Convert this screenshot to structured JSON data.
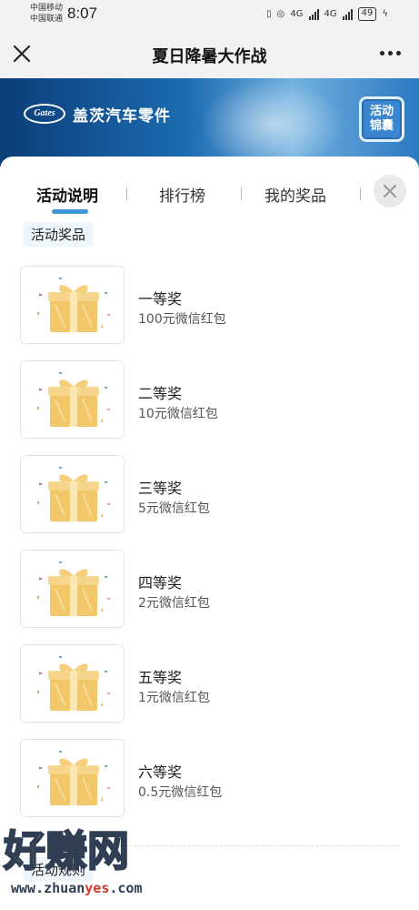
{
  "status_bar": {
    "carrier_1": "中国移动",
    "carrier_2": "中国联通",
    "time": "8:07",
    "net_1": "4G",
    "net_2": "4G",
    "battery": "49"
  },
  "nav": {
    "title": "夏日降暑大作战"
  },
  "banner": {
    "logo_text": "Gates",
    "brand": "盖茨汽车零件",
    "bag_button": [
      "活动",
      "锦囊"
    ]
  },
  "tabs": [
    {
      "label": "活动说明",
      "active": true
    },
    {
      "label": "排行榜",
      "active": false
    },
    {
      "label": "我的奖品",
      "active": false
    }
  ],
  "section_title": "活动奖品",
  "prizes": [
    {
      "name": "一等奖",
      "desc": "100元微信红包",
      "icon": "gift-box-icon"
    },
    {
      "name": "二等奖",
      "desc": "10元微信红包",
      "icon": "gift-box-icon"
    },
    {
      "name": "三等奖",
      "desc": "5元微信红包",
      "icon": "gift-box-icon"
    },
    {
      "name": "四等奖",
      "desc": "2元微信红包",
      "icon": "gift-box-icon"
    },
    {
      "name": "五等奖",
      "desc": "1元微信红包",
      "icon": "gift-box-icon"
    },
    {
      "name": "六等奖",
      "desc": "0.5元微信红包",
      "icon": "gift-box-icon"
    }
  ],
  "section_title_2": "活动规则",
  "watermark": {
    "main": "好赚网",
    "url_prefix": "www.zhuan",
    "url_highlight": "yes",
    "url_suffix": ".com"
  },
  "colors": {
    "accent": "#3c97d6",
    "banner_dark": "#0b3d78",
    "gift_gold": "#f2c76a"
  }
}
